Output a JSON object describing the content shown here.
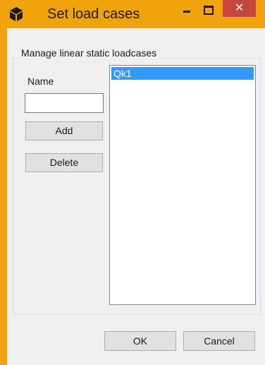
{
  "window": {
    "title": "Set load cases",
    "close_glyph": "✕",
    "accent_color": "#f0a30a",
    "close_color": "#c7463e"
  },
  "icons": {
    "app": "app-cube-icon",
    "minimize": "minimize-icon",
    "maximize": "maximize-icon",
    "close": "close-icon"
  },
  "group": {
    "title": "Manage linear static loadcases"
  },
  "form": {
    "name_label": "Name",
    "name_value": "",
    "add_label": "Add",
    "delete_label": "Delete"
  },
  "loadcases": {
    "items": [
      "Qk1"
    ],
    "selected": "Qk1"
  },
  "footer": {
    "ok_label": "OK",
    "cancel_label": "Cancel"
  }
}
